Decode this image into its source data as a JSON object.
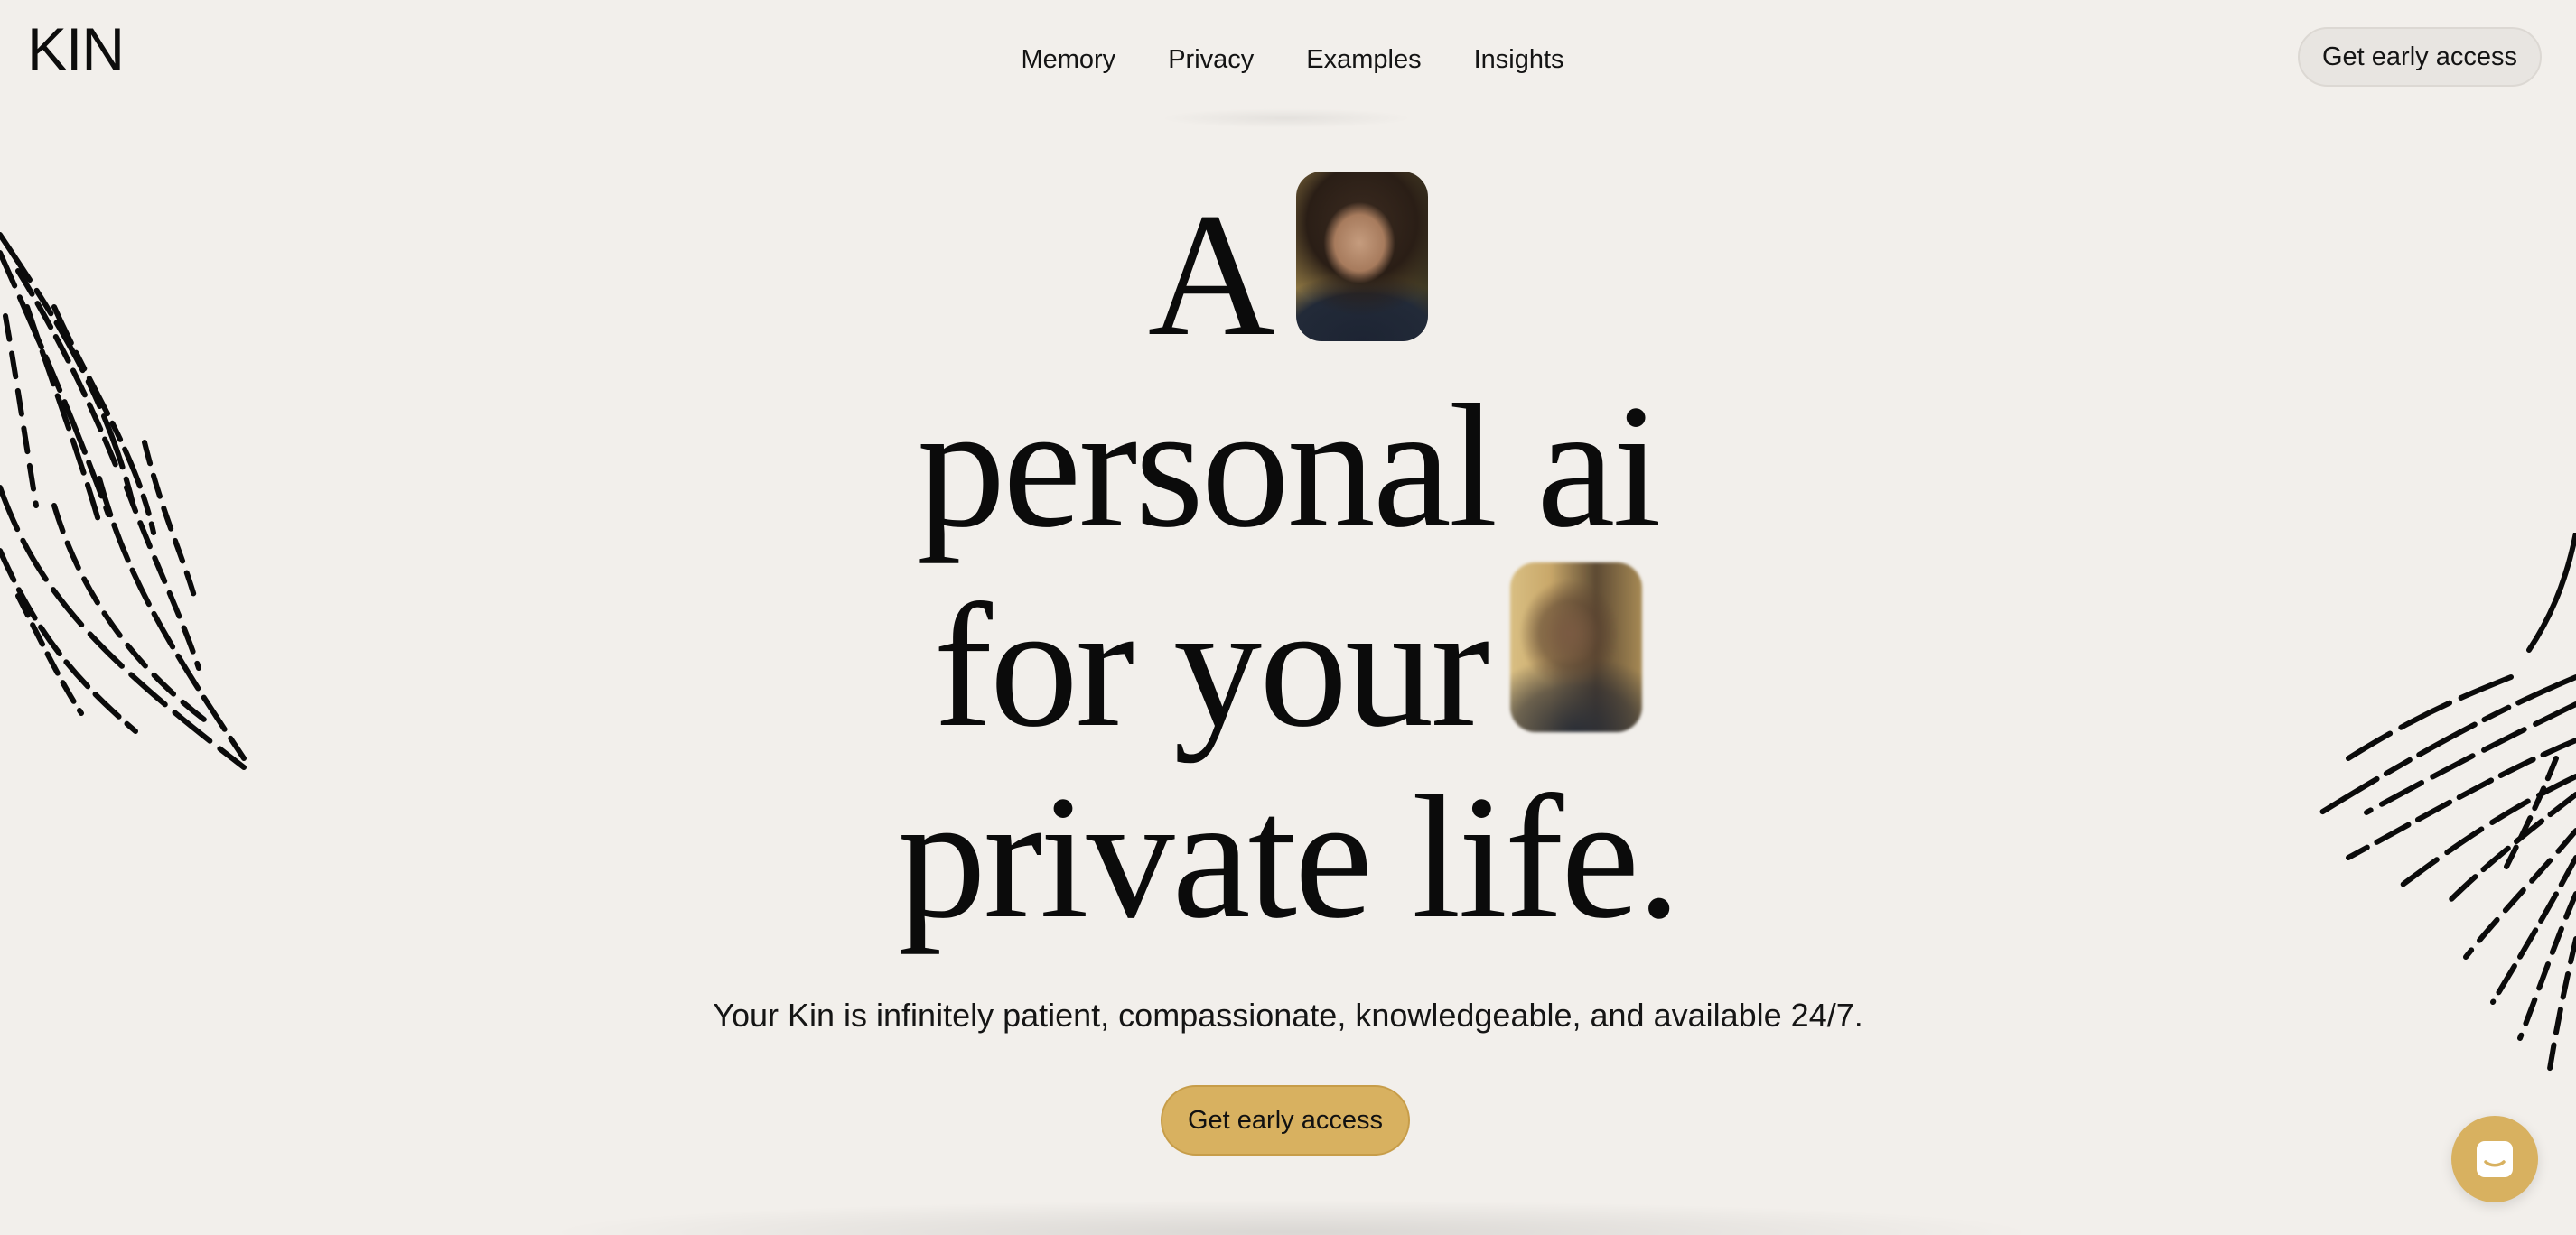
{
  "header": {
    "logo": "KIN",
    "nav": [
      {
        "label": "Memory"
      },
      {
        "label": "Privacy"
      },
      {
        "label": "Examples"
      },
      {
        "label": "Insights"
      }
    ],
    "cta_label": "Get early access"
  },
  "hero": {
    "line1": "A",
    "line2": "personal ai",
    "line3": "for your",
    "line4": "private life.",
    "subtitle": "Your Kin is infinitely patient, compassionate, knowledgeable, and available 24/7.",
    "cta_label": "Get early access",
    "accent_color": "#d8b160"
  },
  "widgets": {
    "chat_icon": "chat-bubble-icon"
  }
}
